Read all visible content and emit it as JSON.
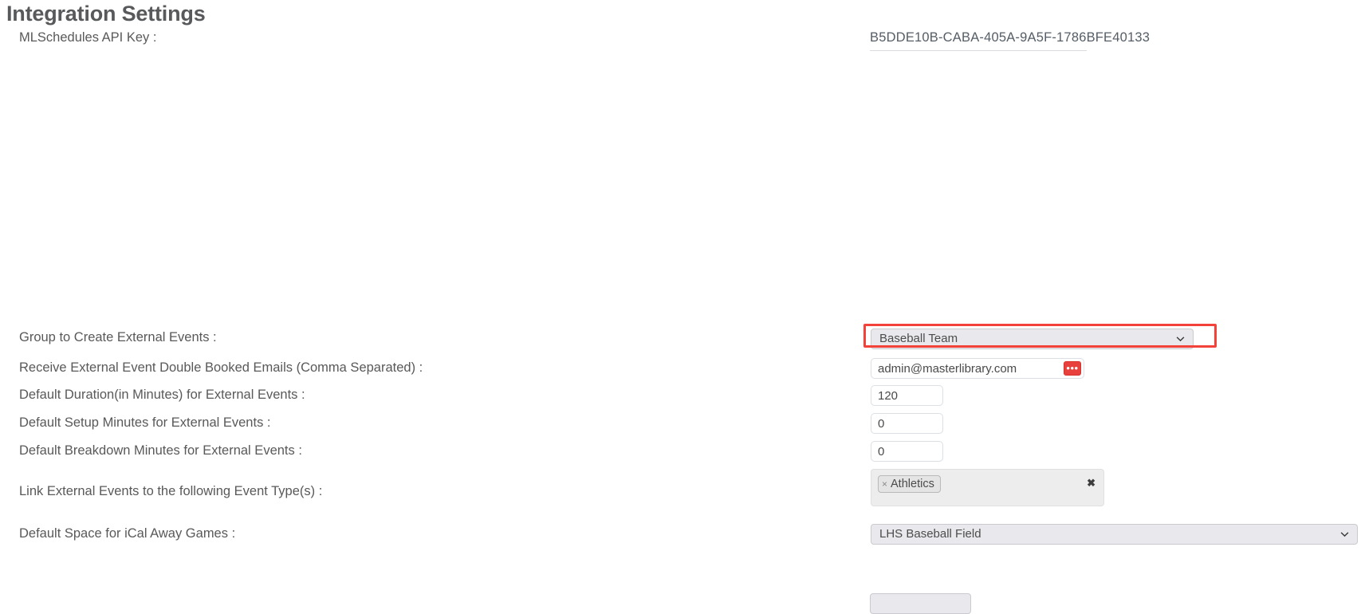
{
  "page": {
    "title": "Integration Settings"
  },
  "api_key": {
    "label": "MLSchedules API Key :",
    "value": "B5DDE10B-CABA-405A-9A5F-1786BFE40133"
  },
  "fields": {
    "group_to_create": {
      "label": "Group to Create External Events :",
      "value": "Baseball Team",
      "options": [
        "Baseball Team"
      ],
      "highlighted": true,
      "highlight_color": "#f4423a"
    },
    "double_booked_emails": {
      "label": "Receive External Event Double Booked Emails (Comma Separated) :",
      "value": "admin@masterlibrary.com",
      "button_label": "•••",
      "button_color": "#e8403c"
    },
    "default_duration": {
      "label": "Default Duration(in Minutes) for External Events :",
      "value": "120"
    },
    "default_setup": {
      "label": "Default Setup Minutes for External Events :",
      "value": "0"
    },
    "default_breakdown": {
      "label": "Default Breakdown Minutes for External Events :",
      "value": "0"
    },
    "event_types": {
      "label": "Link External Events to the following Event Type(s) :",
      "tags": [
        {
          "remove": "×",
          "label": "Athletics"
        }
      ],
      "clear_all": "✖"
    },
    "default_space_ical": {
      "label": "Default Space for iCal Away Games :",
      "value": "LHS Baseball Field",
      "options": [
        "LHS Baseball Field"
      ]
    }
  }
}
